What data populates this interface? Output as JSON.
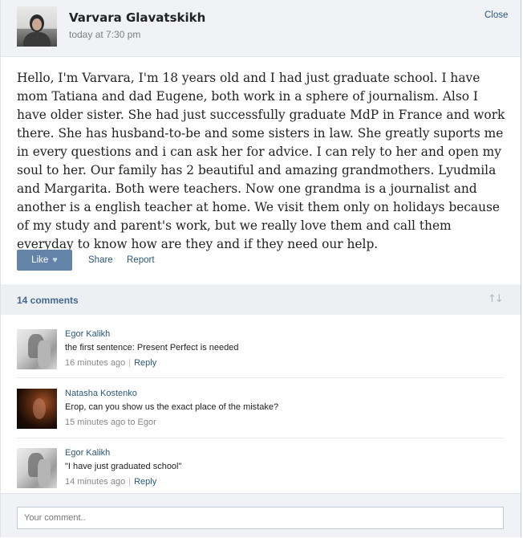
{
  "post": {
    "author": "Varvara Glavatskikh",
    "time": "today at 7:30 pm",
    "close_label": "Close",
    "body": "Hello, I'm Varvara, I'm 18 years old and I had just graduate school. I have mom Tatiana and dad Eugene, both work in a sphere of journalism. Also I have older sister. She had just successfully graduate MdP in France and work there. She has husband-to-be and some sisters in law. She greatly suports me in every questions and i can ask her for advice. I can rely to her and open my soul to her. Our family has 2 beautiful and amazing grandmothers. Lyudmila and Margarita. Both were teachers. Now one grandma is a journalist and another is a english teacher at home. We visit them only on holidays because of my study and parent's work, but we really love them and call them everyday to know how are they and if they need our help."
  },
  "actions": {
    "like_label": "Like",
    "like_icon": "heart-icon",
    "share_label": "Share",
    "report_label": "Report"
  },
  "comments_header": {
    "count_label": "14 comments",
    "sort_icon": "sort-arrows-icon"
  },
  "comments": [
    {
      "author": "Egor Kalikh",
      "text": "the first sentence: Present Perfect is needed",
      "time": "16 minutes ago",
      "reply_label": "Reply"
    },
    {
      "author": "Natasha Kostenko",
      "text": "Егор, can you show us the exact place of the mistake?",
      "time": "15 minutes ago",
      "to_label": "to Egor"
    },
    {
      "author": "Egor Kalikh",
      "text": "\"I have just graduated school\"",
      "time": "14 minutes ago",
      "reply_label": "Reply"
    }
  ],
  "comment_input": {
    "placeholder": "Your comment.."
  },
  "colors": {
    "link": "#2b587a",
    "like_button": "#6383a8",
    "header_bg": "#f0f2f5"
  }
}
